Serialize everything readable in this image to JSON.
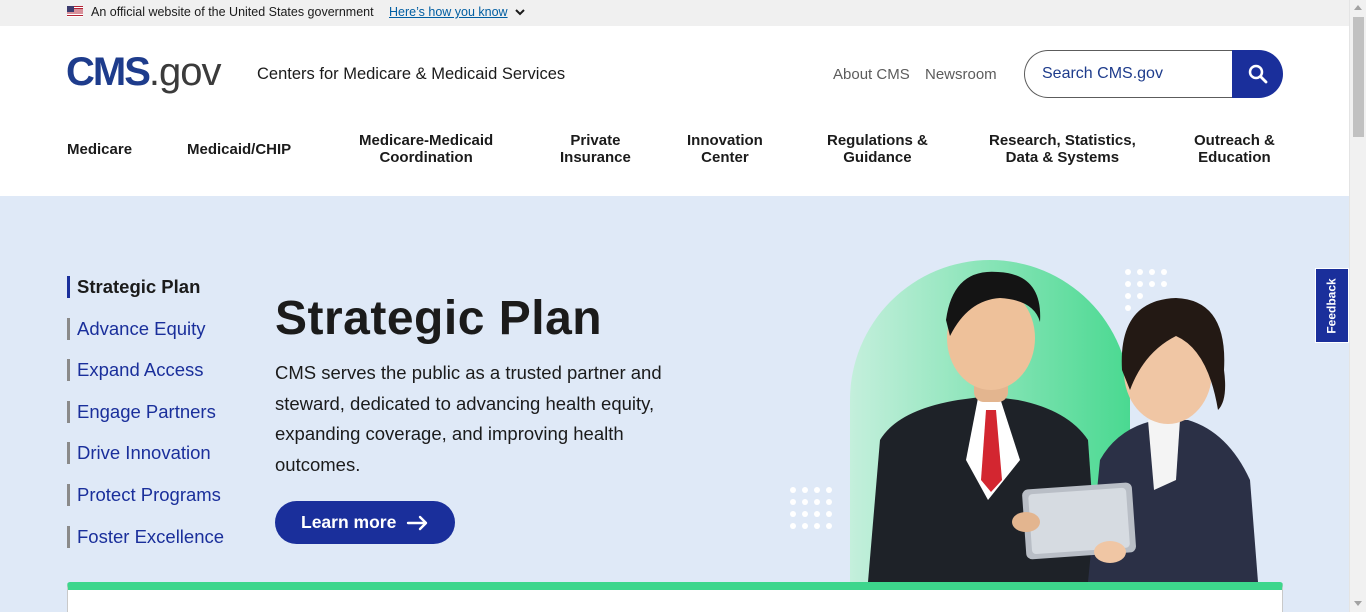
{
  "gov_banner": {
    "text": "An official website of the United States government",
    "link": "Here’s how you know"
  },
  "header": {
    "logo_cms": "CMS",
    "logo_gov": ".gov",
    "agency": "Centers for Medicare & Medicaid Services",
    "top_links": [
      "About CMS",
      "Newsroom"
    ],
    "search_placeholder": "Search CMS.gov"
  },
  "nav": [
    {
      "line1": "Medicare",
      "line2": ""
    },
    {
      "line1": "Medicaid/CHIP",
      "line2": ""
    },
    {
      "line1": "Medicare-Medicaid",
      "line2": "Coordination"
    },
    {
      "line1": "Private",
      "line2": "Insurance"
    },
    {
      "line1": "Innovation",
      "line2": "Center"
    },
    {
      "line1": "Regulations &",
      "line2": "Guidance"
    },
    {
      "line1": "Research, Statistics,",
      "line2": "Data & Systems"
    },
    {
      "line1": "Outreach &",
      "line2": "Education"
    }
  ],
  "side_nav": [
    "Strategic Plan",
    "Advance Equity",
    "Expand Access",
    "Engage Partners",
    "Drive Innovation",
    "Protect Programs",
    "Foster Excellence"
  ],
  "hero": {
    "title": "Strategic Plan",
    "description": "CMS serves the public as a trusted partner and steward, dedicated to advancing health equity, expanding coverage, and improving health outcomes.",
    "button": "Learn more"
  },
  "feedback_label": "Feedback",
  "colors": {
    "primary_blue": "#1a2f9b",
    "hero_bg": "#dfe9f7",
    "accent_green": "#3dd68c"
  }
}
